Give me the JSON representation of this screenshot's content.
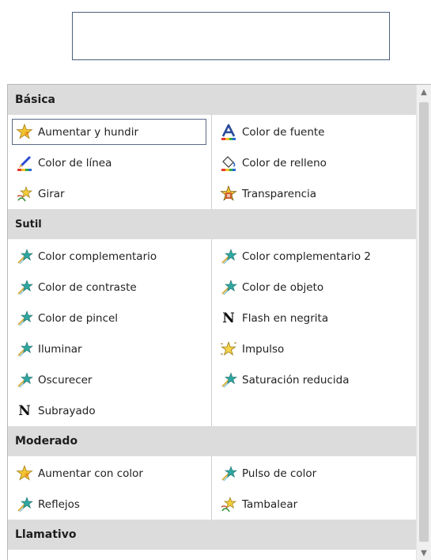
{
  "preview": {
    "text": ""
  },
  "sections": [
    {
      "title": "Básica",
      "left": [
        {
          "label": "Aumentar y hundir",
          "icon": "grow-shrink-icon",
          "selected": true
        },
        {
          "label": "Color de línea",
          "icon": "line-color-icon"
        },
        {
          "label": "Girar",
          "icon": "spin-icon"
        }
      ],
      "right": [
        {
          "label": "Color de fuente",
          "icon": "font-color-icon"
        },
        {
          "label": "Color de relleno",
          "icon": "fill-color-icon"
        },
        {
          "label": "Transparencia",
          "icon": "transparency-icon"
        }
      ]
    },
    {
      "title": "Sutil",
      "left": [
        {
          "label": "Color complementario",
          "icon": "star-effect-icon"
        },
        {
          "label": "Color de contraste",
          "icon": "star-effect-icon"
        },
        {
          "label": "Color de pincel",
          "icon": "star-effect-icon"
        },
        {
          "label": "Iluminar",
          "icon": "star-effect-icon"
        },
        {
          "label": "Oscurecer",
          "icon": "star-effect-icon"
        },
        {
          "label": "Subrayado",
          "icon": "bold-n-icon"
        }
      ],
      "right": [
        {
          "label": "Color complementario 2",
          "icon": "star-effect-icon"
        },
        {
          "label": "Color de objeto",
          "icon": "star-effect-icon"
        },
        {
          "label": "Flash en negrita",
          "icon": "bold-n-icon"
        },
        {
          "label": "Impulso",
          "icon": "pulse-star-icon"
        },
        {
          "label": "Saturación reducida",
          "icon": "star-effect-icon"
        }
      ]
    },
    {
      "title": "Moderado",
      "left": [
        {
          "label": "Aumentar con color",
          "icon": "grow-shrink-icon"
        },
        {
          "label": "Reflejos",
          "icon": "star-effect-icon"
        }
      ],
      "right": [
        {
          "label": "Pulso de color",
          "icon": "star-effect-icon"
        },
        {
          "label": "Tambalear",
          "icon": "spin-icon"
        }
      ]
    },
    {
      "title": "Llamativo",
      "left": [],
      "right": []
    }
  ],
  "scrollbar": {
    "up_arrow": "▲",
    "down_arrow": "▼"
  }
}
